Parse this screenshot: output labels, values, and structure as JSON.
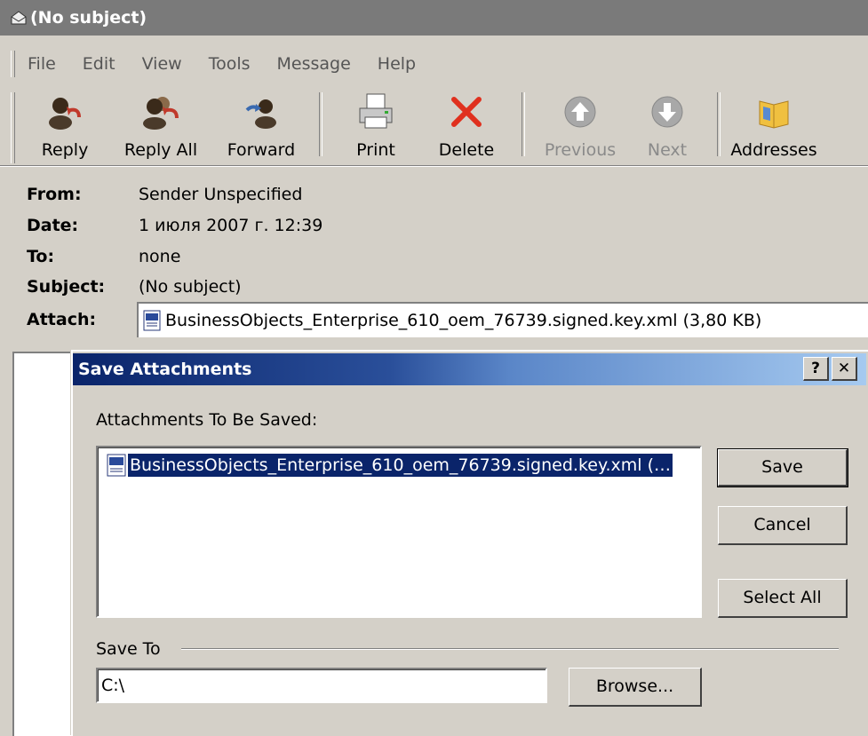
{
  "window": {
    "title": "(No subject)"
  },
  "menu": [
    "File",
    "Edit",
    "View",
    "Tools",
    "Message",
    "Help"
  ],
  "toolbar": {
    "reply": "Reply",
    "reply_all": "Reply All",
    "forward": "Forward",
    "print": "Print",
    "delete": "Delete",
    "previous": "Previous",
    "next": "Next",
    "addresses": "Addresses"
  },
  "header": {
    "from_label": "From:",
    "from_value": "Sender Unspecified",
    "date_label": "Date:",
    "date_value": "1 июля 2007 г. 12:39",
    "to_label": "To:",
    "to_value": "none",
    "subject_label": "Subject:",
    "subject_value": "(No subject)",
    "attach_label": "Attach:",
    "attach_value": "BusinessObjects_Enterprise_610_oem_76739.signed.key.xml (3,80 KB)"
  },
  "dialog": {
    "title": "Save Attachments",
    "help_button": "?",
    "close_button": "✕",
    "list_label": "Attachments To Be Saved:",
    "items": [
      "BusinessObjects_Enterprise_610_oem_76739.signed.key.xml (…"
    ],
    "save_button": "Save",
    "cancel_button": "Cancel",
    "select_all_button": "Select All",
    "save_to_label": "Save To",
    "save_to_value": "C:\\",
    "browse_button": "Browse..."
  },
  "colors": {
    "face": "#d4d0c8",
    "selection": "#0a246a",
    "delete_red": "#e0301e",
    "title_gradient_start": "#0a246a",
    "title_gradient_end": "#a6caf0"
  }
}
